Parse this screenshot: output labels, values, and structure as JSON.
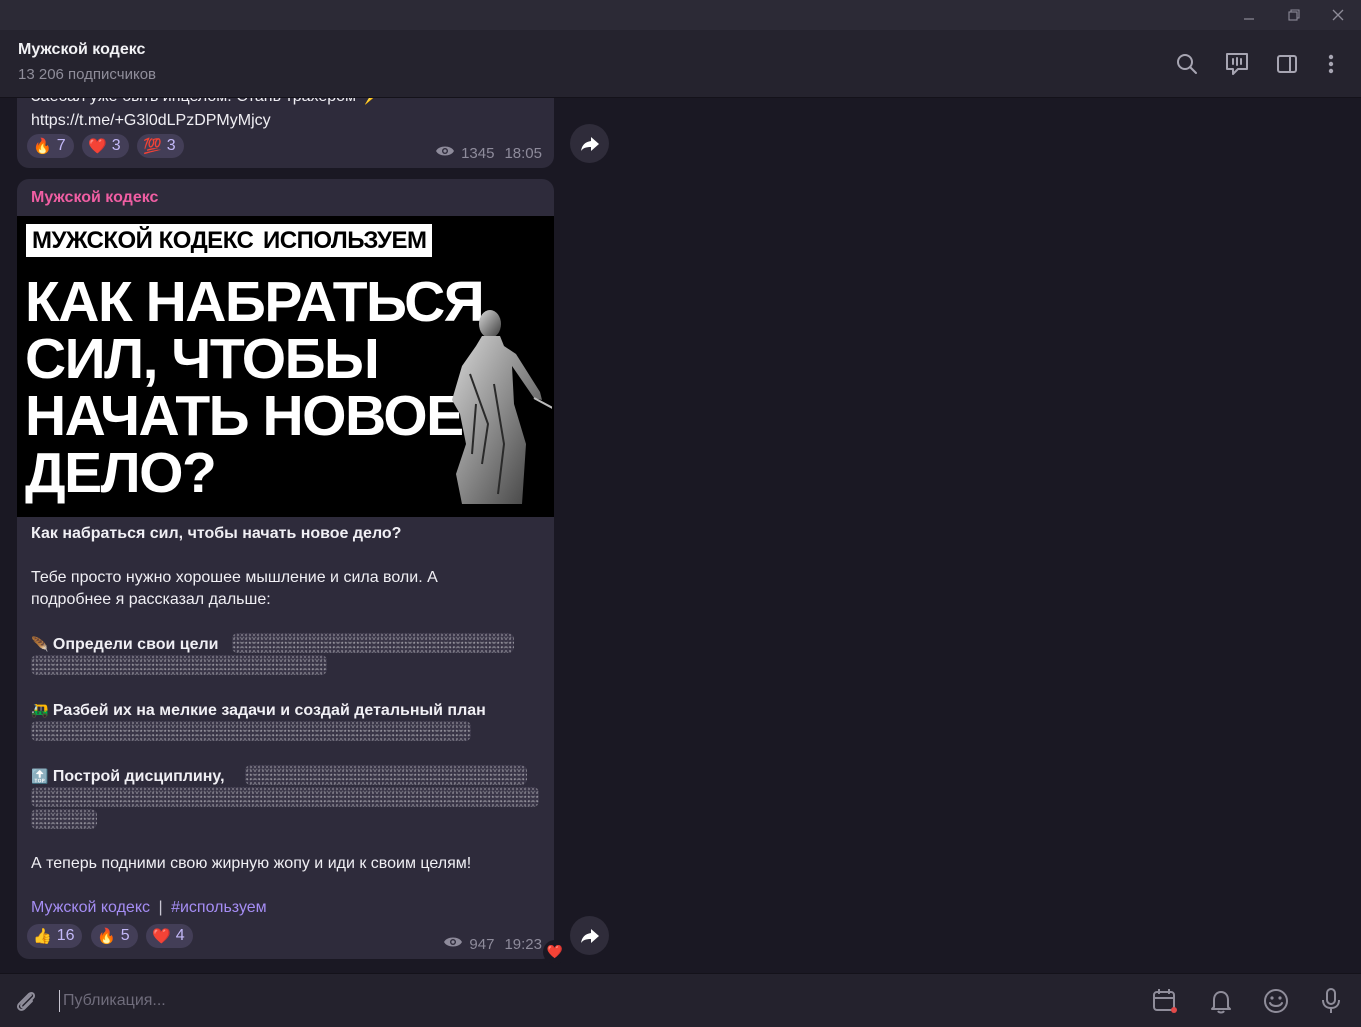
{
  "window": {
    "minimize_icon": "minimize-icon",
    "restore_icon": "restore-icon",
    "close_icon": "close-icon"
  },
  "header": {
    "title": "Мужской кодекс",
    "subtitle": "13 206 подписчиков",
    "icons": [
      "search-icon",
      "video-chat-icon",
      "sidebar-toggle-icon",
      "more-vertical-icon"
    ]
  },
  "messages": [
    {
      "partial_text": "Заебал уже быть инцелом. Стань трахером ⚡",
      "link": "https://t.me/+G3l0dLPzDPMyMjcy",
      "reactions": [
        {
          "emoji": "🔥",
          "count": "7"
        },
        {
          "emoji": "❤️",
          "count": "3"
        },
        {
          "emoji": "💯",
          "count": "3"
        }
      ],
      "views": "1345",
      "time": "18:05"
    },
    {
      "author": "Мужской кодекс",
      "banner": {
        "tags": [
          "МУЖСКОЙ КОДЕКС",
          "ИСПОЛЬЗУЕМ"
        ],
        "headline": [
          "КАК НАБРАТЬСЯ",
          "СИЛ, ЧТОБЫ",
          "НАЧАТЬ НОВОЕ",
          "ДЕЛО?"
        ]
      },
      "title": "Как набраться сил, чтобы начать новое дело?",
      "intro": "Тебе просто нужно хорошее мышление и сила воли. А подробнее я рассказал дальше:",
      "points": [
        {
          "emoji": "🪶",
          "text": "Определи свои цели"
        },
        {
          "emoji": "🛺",
          "text": "Разбей их на мелкие задачи и создай детальный план"
        },
        {
          "emoji": "🔝",
          "text": "Построй дисциплину,"
        }
      ],
      "outro": "А теперь подними свою жирную жопу и иди к своим целям!",
      "footer_link1": "Мужской кодекс",
      "footer_sep": "|",
      "footer_link2": "#используем",
      "reactions": [
        {
          "emoji": "👍",
          "count": "16"
        },
        {
          "emoji": "🔥",
          "count": "5"
        },
        {
          "emoji": "❤️",
          "count": "4"
        }
      ],
      "views": "947",
      "time": "19:23",
      "own_reaction": "❤️"
    }
  ],
  "composer": {
    "placeholder": "Публикация...",
    "icons": [
      "attach-icon",
      "schedule-icon",
      "notification-bell-icon",
      "emoji-icon",
      "microphone-icon"
    ]
  },
  "colors": {
    "accent": "#a58df4",
    "author": "#f05ea3",
    "bubble": "#2e2b3b",
    "background": "#1a1823"
  }
}
